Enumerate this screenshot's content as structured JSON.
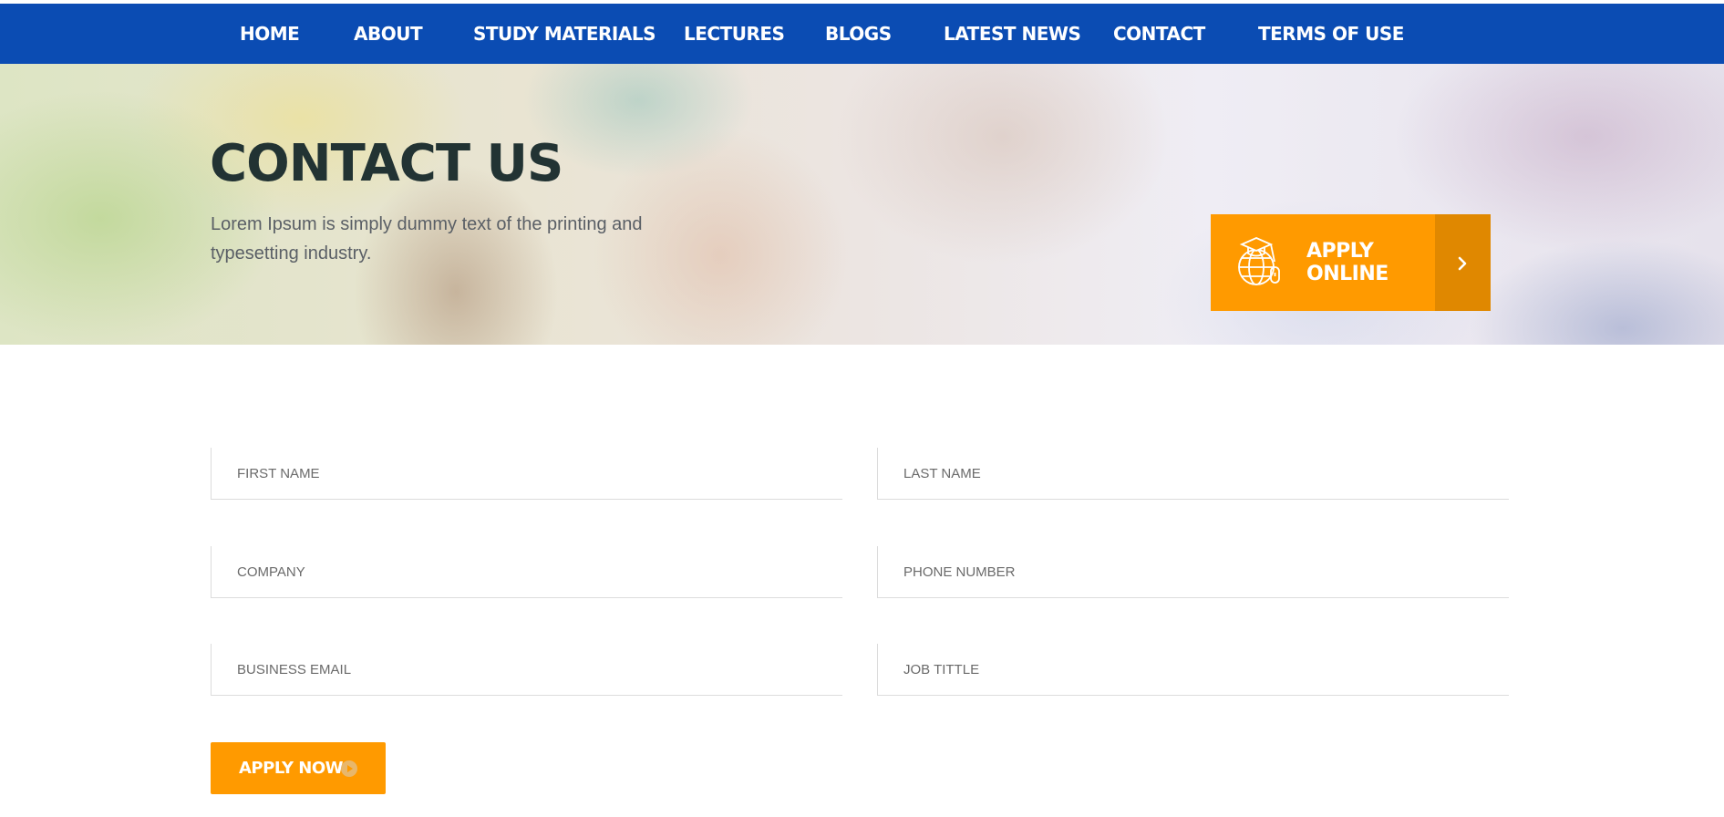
{
  "nav": {
    "items": [
      {
        "label": "HOME"
      },
      {
        "label": "ABOUT"
      },
      {
        "label": "STUDY MATERIALS"
      },
      {
        "label": "LECTURES"
      },
      {
        "label": "BLOGS"
      },
      {
        "label": "LATEST NEWS"
      },
      {
        "label": "CONTACT"
      },
      {
        "label": "TERMS OF USE"
      }
    ]
  },
  "hero": {
    "title": "CONTACT US",
    "description": "Lorem Ipsum is simply dummy text of the printing and typesetting industry.",
    "apply_online": {
      "line1": "APPLY",
      "line2": "ONLINE",
      "icon": "globe-graduation-cap-icon",
      "arrow_icon": "chevron-right-icon"
    }
  },
  "form": {
    "first_name_placeholder": "FIRST NAME",
    "last_name_placeholder": "LAST NAME",
    "company_placeholder": "COMPANY",
    "phone_placeholder": "PHONE NUMBER",
    "email_placeholder": "BUSINESS EMAIL",
    "job_title_placeholder": "JOB TITTLE",
    "submit_label": "APPLY NOW",
    "submit_icon": "play-circle-icon"
  },
  "colors": {
    "nav_bg": "#0b4cb3",
    "accent": "#ff9a00",
    "accent_dark": "#e08800",
    "title": "#223333"
  }
}
